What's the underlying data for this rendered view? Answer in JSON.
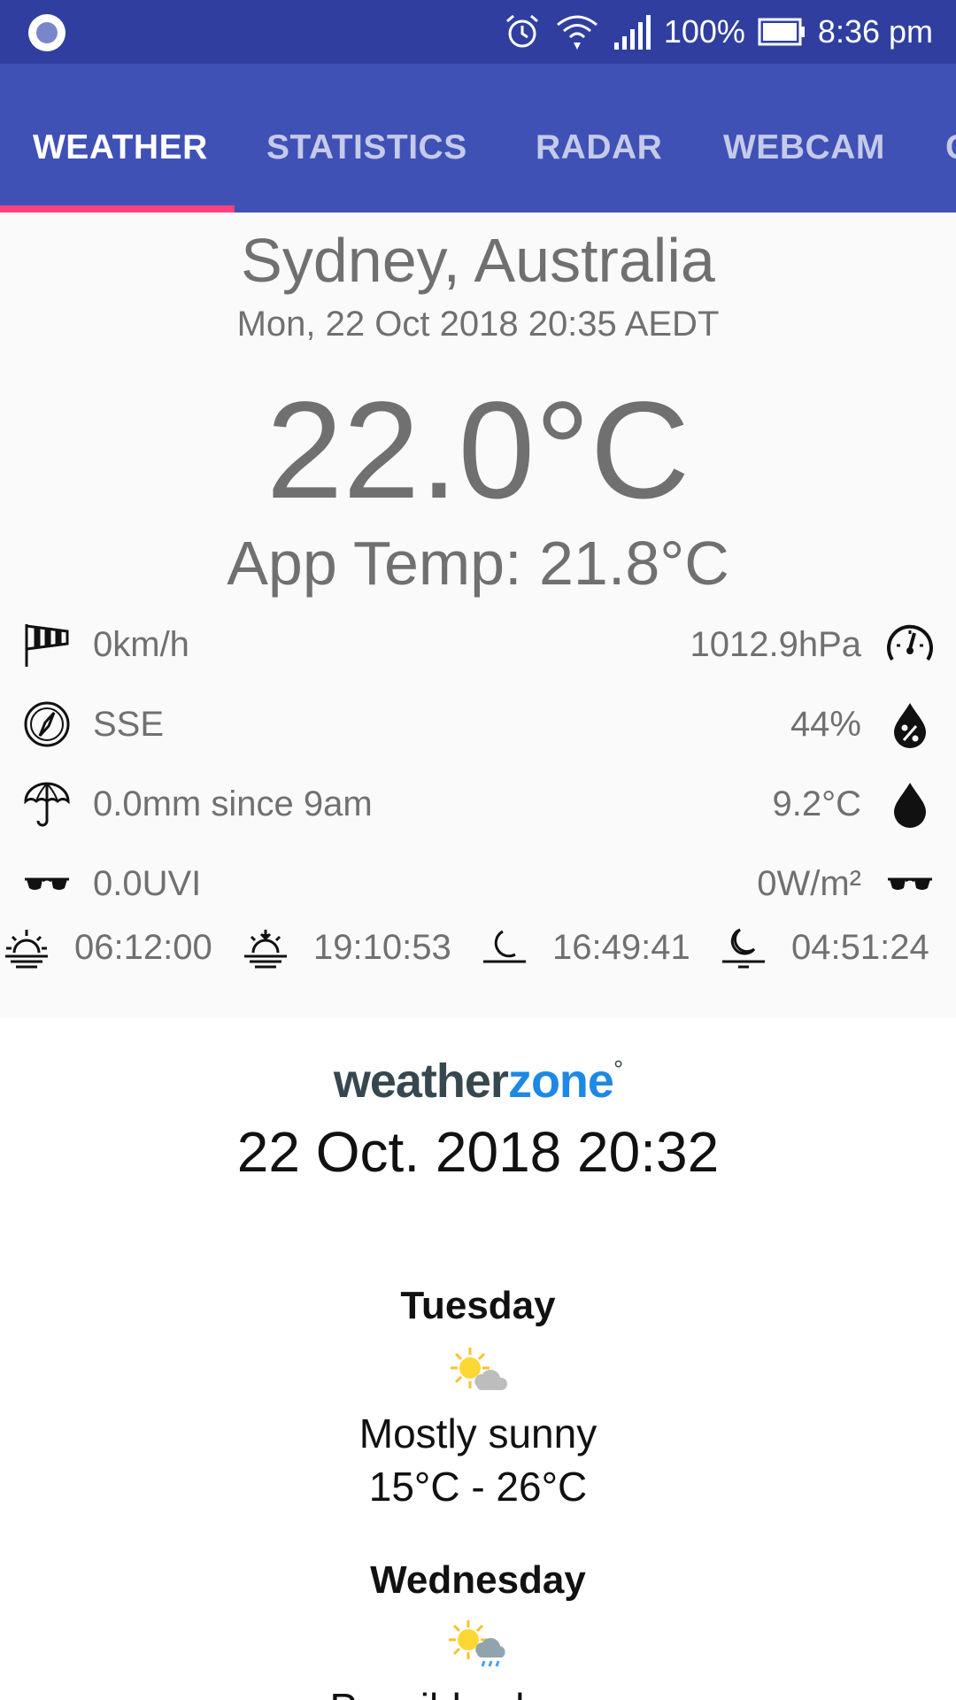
{
  "status_bar": {
    "battery": "100%",
    "time": "8:36 pm",
    "icons": [
      "app-circle-icon",
      "alarm-icon",
      "wifi-icon",
      "signal-icon",
      "battery-icon"
    ]
  },
  "tabs": [
    {
      "label": "WEATHER",
      "active": true
    },
    {
      "label": "STATISTICS",
      "active": false
    },
    {
      "label": "RADAR",
      "active": false
    },
    {
      "label": "WEBCAM",
      "active": false
    },
    {
      "label": "C",
      "active": false
    }
  ],
  "current": {
    "location": "Sydney, Australia",
    "datetime": "Mon, 22 Oct 2018 20:35 AEDT",
    "temperature": "22.0°C",
    "app_temp": "App Temp: 21.8°C",
    "rows": [
      {
        "left_icon": "windsock-icon",
        "left": "0km/h",
        "right": "1012.9hPa",
        "right_icon": "gauge-icon"
      },
      {
        "left_icon": "compass-icon",
        "left": "SSE",
        "right": "44%",
        "right_icon": "humidity-drop-icon"
      },
      {
        "left_icon": "umbrella-icon",
        "left": "0.0mm since 9am",
        "right": "9.2°C",
        "right_icon": "dewpoint-drop-icon"
      },
      {
        "left_icon": "sunglasses-icon",
        "left": "0.0UVI",
        "right": "0W/m²",
        "right_icon": "sunglasses-icon"
      }
    ],
    "sun_moon": [
      {
        "icon": "sunrise-icon",
        "time": "06:12:00"
      },
      {
        "icon": "sunset-icon",
        "time": "19:10:53"
      },
      {
        "icon": "moonrise-icon",
        "time": "16:49:41"
      },
      {
        "icon": "moonset-icon",
        "time": "04:51:24"
      }
    ]
  },
  "forecast": {
    "provider_logo": {
      "part1": "weather",
      "part2": "zone",
      "mark": "°"
    },
    "issued": "22 Oct. 2018 20:32",
    "days": [
      {
        "name": "Tuesday",
        "icon": "sun-cloud-icon",
        "description": "Mostly sunny",
        "range": "15°C - 26°C"
      },
      {
        "name": "Wednesday",
        "icon": "sun-shower-icon",
        "description": "Possible shower",
        "range": ""
      }
    ]
  },
  "colors": {
    "status_bar": "#303f9f",
    "toolbar": "#3f51b5",
    "tab_indicator": "#ff4081",
    "text_grey": "#707070",
    "weatherzone_blue": "#1e88e5"
  }
}
